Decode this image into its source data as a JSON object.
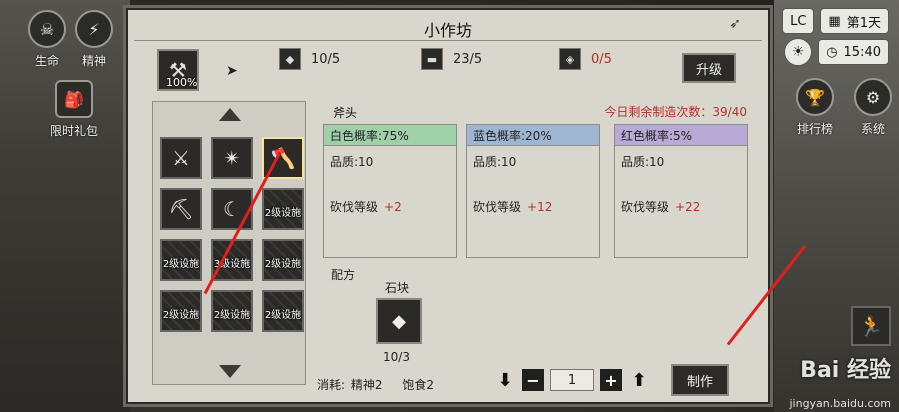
{
  "hud": {
    "life_label": "生命",
    "spirit_label": "精神",
    "gift_label": "限时礼包",
    "day_label": "第1天",
    "time_label": "15:40",
    "ranking_label": "排行榜",
    "system_label": "系统",
    "clock_prefix": "LC"
  },
  "panel": {
    "title": "小作坊",
    "facility_progress": "100%",
    "resources": [
      {
        "icon": "stone-icon",
        "value": "10/5",
        "color": "#111111"
      },
      {
        "icon": "wood-icon",
        "value": "23/5",
        "color": "#111111"
      },
      {
        "icon": "ore-icon",
        "value": "0/5",
        "color": "#b0302a"
      }
    ],
    "upgrade_label": "升级"
  },
  "grid": {
    "slots": [
      {
        "icon": "sword-icon",
        "glyph": "⚔",
        "label": "",
        "locked": false,
        "selected": false
      },
      {
        "icon": "spiked-blade-icon",
        "glyph": "✴",
        "label": "",
        "locked": false,
        "selected": false
      },
      {
        "icon": "axe-icon",
        "glyph": "🪓",
        "label": "",
        "locked": false,
        "selected": true
      },
      {
        "icon": "pickaxe-icon",
        "glyph": "⛏",
        "label": "",
        "locked": false,
        "selected": false
      },
      {
        "icon": "sickle-icon",
        "glyph": "☾",
        "label": "",
        "locked": false,
        "selected": false
      },
      {
        "icon": "lock-icon",
        "glyph": "",
        "label": "2级设施",
        "locked": true,
        "selected": false
      },
      {
        "icon": "lock-icon",
        "glyph": "",
        "label": "2级设施",
        "locked": true,
        "selected": false
      },
      {
        "icon": "lock-icon",
        "glyph": "",
        "label": "3级设施",
        "locked": true,
        "selected": false
      },
      {
        "icon": "lock-icon",
        "glyph": "",
        "label": "2级设施",
        "locked": true,
        "selected": false
      },
      {
        "icon": "lock-icon",
        "glyph": "",
        "label": "2级设施",
        "locked": true,
        "selected": false
      },
      {
        "icon": "lock-icon",
        "glyph": "",
        "label": "2级设施",
        "locked": true,
        "selected": false
      },
      {
        "icon": "lock-icon",
        "glyph": "",
        "label": "2级设施",
        "locked": true,
        "selected": false
      }
    ]
  },
  "detail": {
    "item_name": "斧头",
    "remain_text": "今日剩余制造次数：39/40",
    "columns": [
      {
        "rate": "白色概率:75%",
        "color": "#9fd0a8",
        "quality": "品质:10",
        "stat": "砍伐等级",
        "bonus": "+2"
      },
      {
        "rate": "蓝色概率:20%",
        "color": "#9fb6d2",
        "quality": "品质:10",
        "stat": "砍伐等级",
        "bonus": "+12"
      },
      {
        "rate": "红色概率:5%",
        "color": "#b8aad6",
        "quality": "品质:10",
        "stat": "砍伐等级",
        "bonus": "+22"
      }
    ],
    "recipe_label": "配方",
    "material_name": "石块",
    "material_count": "10/3",
    "consume_label": "消耗:",
    "consume_spirit": "精神2",
    "consume_food": "饱食2",
    "quantity": "1",
    "make_label": "制作"
  },
  "watermark": {
    "brand": "Bai 经验",
    "url": "jingyan.baidu.com"
  }
}
